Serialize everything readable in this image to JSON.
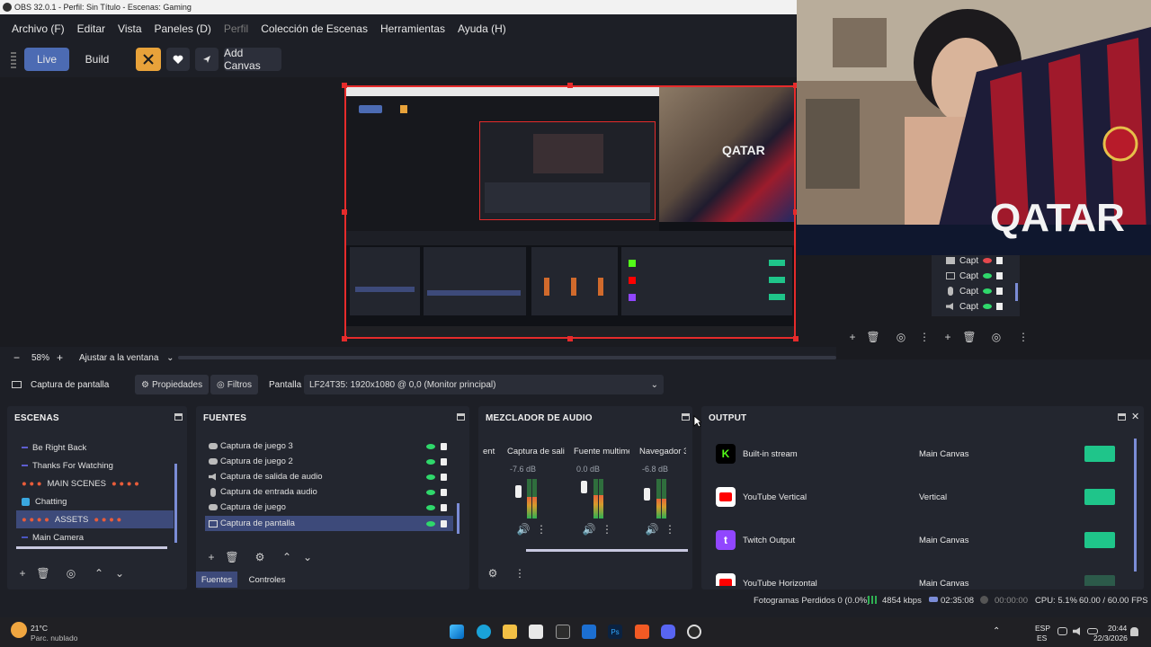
{
  "window": {
    "title": "OBS 32.0.1 - Perfil: Sin Título - Escenas: Gaming"
  },
  "menu": [
    "Archivo (F)",
    "Editar",
    "Vista",
    "Paneles (D)",
    "Perfil",
    "Colección de Escenas",
    "Herramientas",
    "Ayuda (H)"
  ],
  "toolbar": {
    "live": "Live",
    "build": "Build",
    "add_canvas": "Add Canvas"
  },
  "zoom": {
    "minus": "−",
    "value": "58%",
    "plus": "+",
    "fit": "Ajustar a la ventana"
  },
  "source_bar": {
    "source_name": "Captura de pantalla",
    "properties": "Propiedades",
    "filters": "Filtros",
    "display_label": "Pantalla",
    "display_value": "LF24T35: 1920x1080 @ 0,0 (Monitor principal)"
  },
  "scenes": {
    "title": "ESCENAS",
    "items": [
      {
        "label": "Be Right Back"
      },
      {
        "label": "Thanks For Watching"
      },
      {
        "label": "MAIN SCENES"
      },
      {
        "label": "Chatting"
      },
      {
        "label": "ASSETS"
      },
      {
        "label": "Main Camera"
      }
    ]
  },
  "sources": {
    "title": "FUENTES",
    "items": [
      {
        "label": "Captura de juego 3"
      },
      {
        "label": "Captura de juego 2"
      },
      {
        "label": "Captura de salida de audio"
      },
      {
        "label": "Captura de entrada audio"
      },
      {
        "label": "Captura de juego"
      },
      {
        "label": "Captura de pantalla"
      }
    ],
    "tab_sources": "Fuentes",
    "tab_controls": "Controles"
  },
  "mixer": {
    "title": "MEZCLADOR DE AUDIO",
    "partial": "ent",
    "channels": [
      {
        "name": "Captura de sali",
        "db": "-7.6 dB",
        "level": 0.55
      },
      {
        "name": "Fuente multime",
        "db": "0.0 dB",
        "level": 0.6
      },
      {
        "name": "Navegador 3",
        "db": "-6.8 dB",
        "level": 0.5
      }
    ]
  },
  "output": {
    "title": "OUTPUT",
    "rows": [
      {
        "name": "Built-in stream",
        "target": "Main Canvas",
        "logo": "kick-logo",
        "color": "#53fc18"
      },
      {
        "name": "YouTube Vertical",
        "target": "Vertical",
        "logo": "youtube-logo",
        "color": "#ff0000"
      },
      {
        "name": "Twitch Output",
        "target": "Main Canvas",
        "logo": "twitch-logo",
        "color": "#9146ff"
      },
      {
        "name": "YouTube Horizontal",
        "target": "Main Canvas",
        "logo": "youtube-logo",
        "color": "#ff0000"
      }
    ]
  },
  "mini_sources": {
    "items": [
      {
        "label": "Capt"
      },
      {
        "label": "Capt"
      },
      {
        "label": "Capt"
      },
      {
        "label": "Capt"
      }
    ]
  },
  "status": {
    "frames": "Fotogramas Perdidos 0 (0.0%)",
    "bitrate": "4854 kbps",
    "live_time": "02:35:08",
    "rec_time": "00:00:00",
    "cpu": "CPU: 5.1%",
    "fps": "60.00 / 60.00 FPS"
  },
  "taskbar": {
    "temp": "21°C",
    "weather": "Parc. nublado",
    "lang1": "ESP",
    "lang2": "ES",
    "time": "20:44",
    "date": "22/3/2026"
  },
  "colors": {
    "accent": "#4c6bb3",
    "selection": "#3d4a7a",
    "record_frame": "#e62b2b",
    "green": "#1fc58a"
  }
}
